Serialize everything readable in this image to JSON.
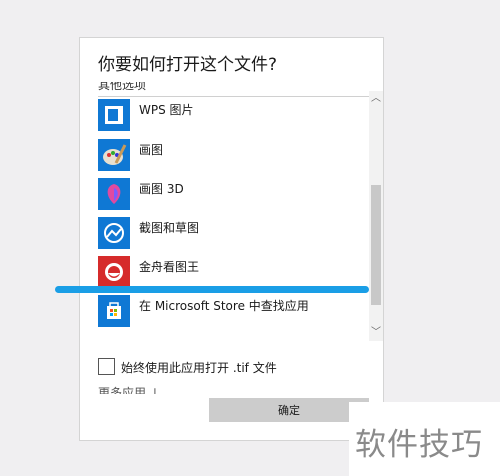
{
  "dialog": {
    "title": "你要如何打开这个文件?",
    "section_label": "其他选项",
    "apps": [
      {
        "label": "WPS 图片",
        "icon": "wps-picture-icon"
      },
      {
        "label": "画图",
        "icon": "paint-icon"
      },
      {
        "label": "画图 3D",
        "icon": "paint3d-icon"
      },
      {
        "label": "截图和草图",
        "icon": "snip-sketch-icon"
      },
      {
        "label": "金舟看图王",
        "icon": "jinzhou-viewer-icon"
      },
      {
        "label": "在 Microsoft Store 中查找应用",
        "icon": "store-icon"
      }
    ],
    "more_apps_label": "更多应用 ↓",
    "always_use_label": "始终使用此应用打开 .tif 文件",
    "ok_label": "确定"
  },
  "watermark": "软件技巧",
  "colors": {
    "accent": "#1a9ee6",
    "tile_blue": "#0f78d4",
    "annotation": "#1a9ee6"
  }
}
